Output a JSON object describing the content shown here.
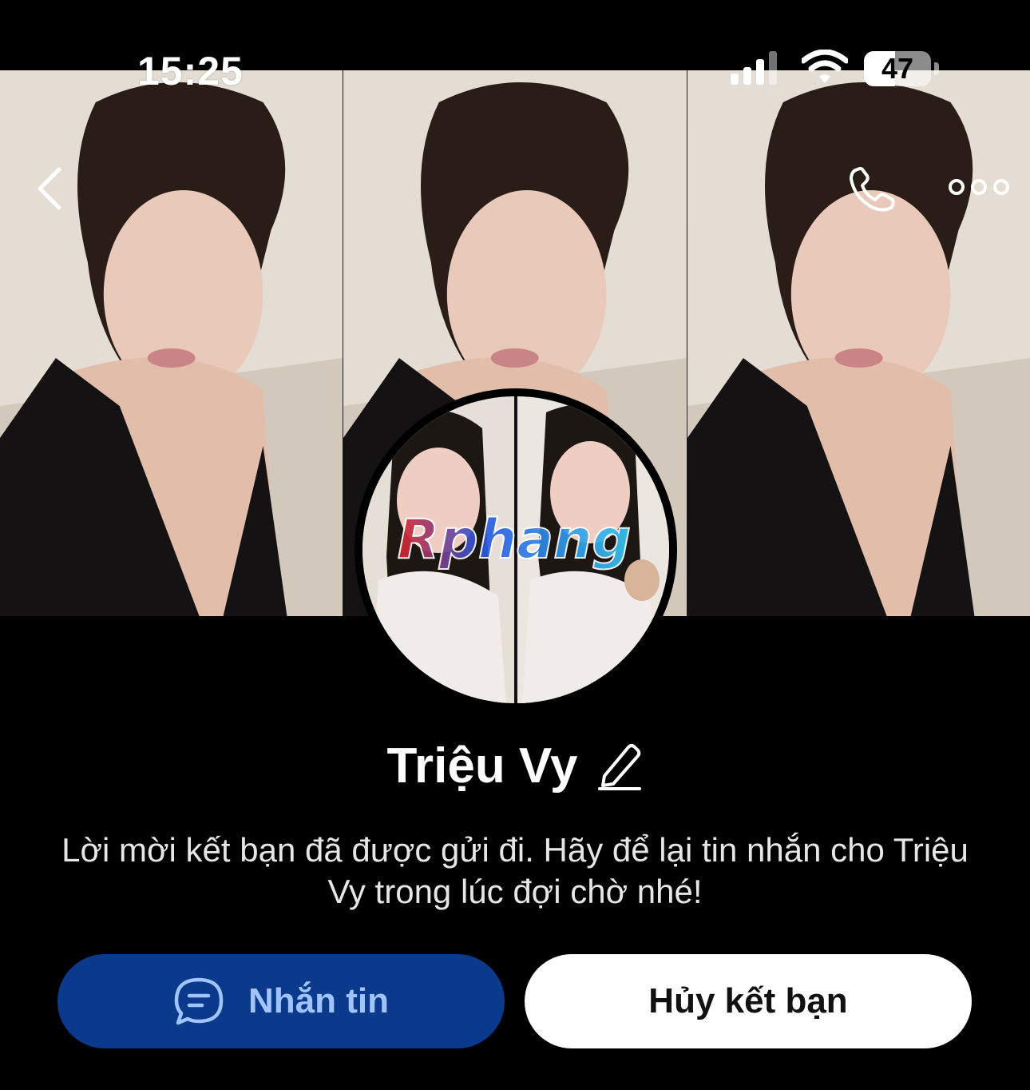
{
  "status_bar": {
    "time": "15:25",
    "battery_level": "47",
    "battery_fraction": 0.47,
    "icons": [
      "signal-icon",
      "wifi-icon",
      "battery-icon"
    ]
  },
  "navigation": {
    "back_icon": "chevron-left-icon",
    "call_icon": "phone-icon",
    "more_icon": "more-options-icon"
  },
  "profile": {
    "name": "Triệu Vy",
    "edit_icon": "pencil-icon",
    "avatar_watermark": "Rphang",
    "friend_request_message": "Lời mời kết bạn đã được gửi đi. Hãy để lại tin nhắn cho Triệu Vy trong lúc đợi chờ nhé!"
  },
  "actions": {
    "message_label": "Nhắn tin",
    "message_icon": "chat-bubble-icon",
    "unfriend_label": "Hủy kết bạn"
  },
  "colors": {
    "background": "#000000",
    "message_button_bg": "#0b3a8c",
    "message_button_text": "#9fc4ff",
    "unfriend_button_bg": "#ffffff",
    "unfriend_button_text": "#111111"
  }
}
